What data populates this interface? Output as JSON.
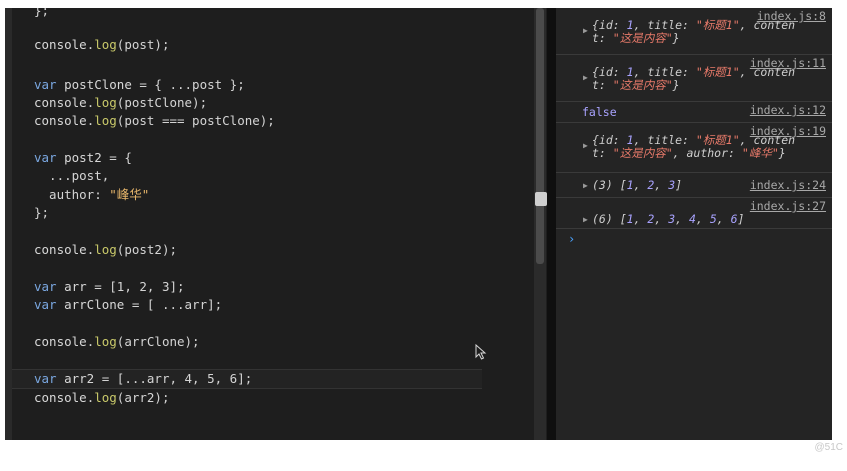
{
  "editor": {
    "lines": [
      [
        {
          "t": "};",
          "c": "def"
        }
      ],
      [
        {
          "t": "console",
          "c": "ident"
        },
        {
          "t": ".",
          "c": "def"
        },
        {
          "t": "log",
          "c": "fn"
        },
        {
          "t": "(post);",
          "c": "def"
        }
      ],
      [
        {
          "t": "var ",
          "c": "kw"
        },
        {
          "t": "postClone",
          "c": "ident"
        },
        {
          "t": " = { ...post };",
          "c": "def"
        }
      ],
      [
        {
          "t": "console",
          "c": "ident"
        },
        {
          "t": ".",
          "c": "def"
        },
        {
          "t": "log",
          "c": "fn"
        },
        {
          "t": "(postClone);",
          "c": "def"
        }
      ],
      [
        {
          "t": "console",
          "c": "ident"
        },
        {
          "t": ".",
          "c": "def"
        },
        {
          "t": "log",
          "c": "fn"
        },
        {
          "t": "(post === postClone);",
          "c": "def"
        }
      ],
      [
        {
          "t": "var ",
          "c": "kw"
        },
        {
          "t": "post2",
          "c": "ident"
        },
        {
          "t": " = {",
          "c": "def"
        }
      ],
      [
        {
          "t": "  ...post,",
          "c": "def"
        }
      ],
      [
        {
          "t": "  author: ",
          "c": "def"
        },
        {
          "t": "\"峰华\"",
          "c": "str"
        }
      ],
      [
        {
          "t": "};",
          "c": "def"
        }
      ],
      [
        {
          "t": "console",
          "c": "ident"
        },
        {
          "t": ".",
          "c": "def"
        },
        {
          "t": "log",
          "c": "fn"
        },
        {
          "t": "(post2);",
          "c": "def"
        }
      ],
      [
        {
          "t": "var ",
          "c": "kw"
        },
        {
          "t": "arr",
          "c": "ident"
        },
        {
          "t": " = [1, 2, 3];",
          "c": "def"
        }
      ],
      [
        {
          "t": "var ",
          "c": "kw"
        },
        {
          "t": "arrClone",
          "c": "ident"
        },
        {
          "t": " = [ ...arr];",
          "c": "def"
        }
      ],
      [
        {
          "t": "console",
          "c": "ident"
        },
        {
          "t": ".",
          "c": "def"
        },
        {
          "t": "log",
          "c": "fn"
        },
        {
          "t": "(arrClone);",
          "c": "def"
        }
      ],
      [
        {
          "t": "var ",
          "c": "kw"
        },
        {
          "t": "arr2",
          "c": "ident"
        },
        {
          "t": " = [...arr, 4, 5, 6];",
          "c": "def"
        }
      ],
      [
        {
          "t": "console",
          "c": "ident"
        },
        {
          "t": ".",
          "c": "def"
        },
        {
          "t": "log",
          "c": "fn"
        },
        {
          "t": "(arr2);",
          "c": "def"
        }
      ]
    ]
  },
  "console": {
    "entries": [
      {
        "source": "index.js:8",
        "kind": "object",
        "lines": [
          [
            {
              "t": "{id: ",
              "c": ""
            },
            {
              "t": "1",
              "c": "num"
            },
            {
              "t": ", title: ",
              "c": ""
            },
            {
              "t": "\"标题1\"",
              "c": "str"
            },
            {
              "t": ", conten",
              "c": ""
            }
          ],
          [
            {
              "t": "t: ",
              "c": ""
            },
            {
              "t": "\"这是内容\"",
              "c": "str"
            },
            {
              "t": "}",
              "c": ""
            }
          ]
        ]
      },
      {
        "source": "index.js:11",
        "kind": "object",
        "lines": [
          [
            {
              "t": "{id: ",
              "c": ""
            },
            {
              "t": "1",
              "c": "num"
            },
            {
              "t": ", title: ",
              "c": ""
            },
            {
              "t": "\"标题1\"",
              "c": "str"
            },
            {
              "t": ", conten",
              "c": ""
            }
          ],
          [
            {
              "t": "t: ",
              "c": ""
            },
            {
              "t": "\"这是内容\"",
              "c": "str"
            },
            {
              "t": "}",
              "c": ""
            }
          ]
        ]
      },
      {
        "source": "index.js:12",
        "kind": "bool",
        "text": "false"
      },
      {
        "source": "index.js:19",
        "kind": "object",
        "lines": [
          [
            {
              "t": "{id: ",
              "c": ""
            },
            {
              "t": "1",
              "c": "num"
            },
            {
              "t": ", title: ",
              "c": ""
            },
            {
              "t": "\"标题1\"",
              "c": "str"
            },
            {
              "t": ", conten",
              "c": ""
            }
          ],
          [
            {
              "t": "t: ",
              "c": ""
            },
            {
              "t": "\"这是内容\"",
              "c": "str"
            },
            {
              "t": ", author: ",
              "c": ""
            },
            {
              "t": "\"峰华\"",
              "c": "str"
            },
            {
              "t": "}",
              "c": ""
            }
          ]
        ]
      },
      {
        "source": "index.js:24",
        "kind": "array",
        "lines": [
          [
            {
              "t": "(3) [",
              "c": ""
            },
            {
              "t": "1",
              "c": "num"
            },
            {
              "t": ", ",
              "c": ""
            },
            {
              "t": "2",
              "c": "num"
            },
            {
              "t": ", ",
              "c": ""
            },
            {
              "t": "3",
              "c": "num"
            },
            {
              "t": "]",
              "c": ""
            }
          ]
        ]
      },
      {
        "source": "index.js:27",
        "kind": "array",
        "lines": [
          [
            {
              "t": "(6) [",
              "c": ""
            },
            {
              "t": "1",
              "c": "num"
            },
            {
              "t": ", ",
              "c": ""
            },
            {
              "t": "2",
              "c": "num"
            },
            {
              "t": ", ",
              "c": ""
            },
            {
              "t": "3",
              "c": "num"
            },
            {
              "t": ", ",
              "c": ""
            },
            {
              "t": "4",
              "c": "num"
            },
            {
              "t": ", ",
              "c": ""
            },
            {
              "t": "5",
              "c": "num"
            },
            {
              "t": ", ",
              "c": ""
            },
            {
              "t": "6",
              "c": "num"
            },
            {
              "t": "]",
              "c": ""
            }
          ]
        ]
      }
    ],
    "prompt_symbol": "›"
  },
  "watermark": "@51C",
  "colors": {
    "keyword": "#7aa7e0",
    "function": "#c9c96a",
    "string": "#e6b56a",
    "console_string": "#e87a6a",
    "console_number": "#a9a3ff"
  }
}
